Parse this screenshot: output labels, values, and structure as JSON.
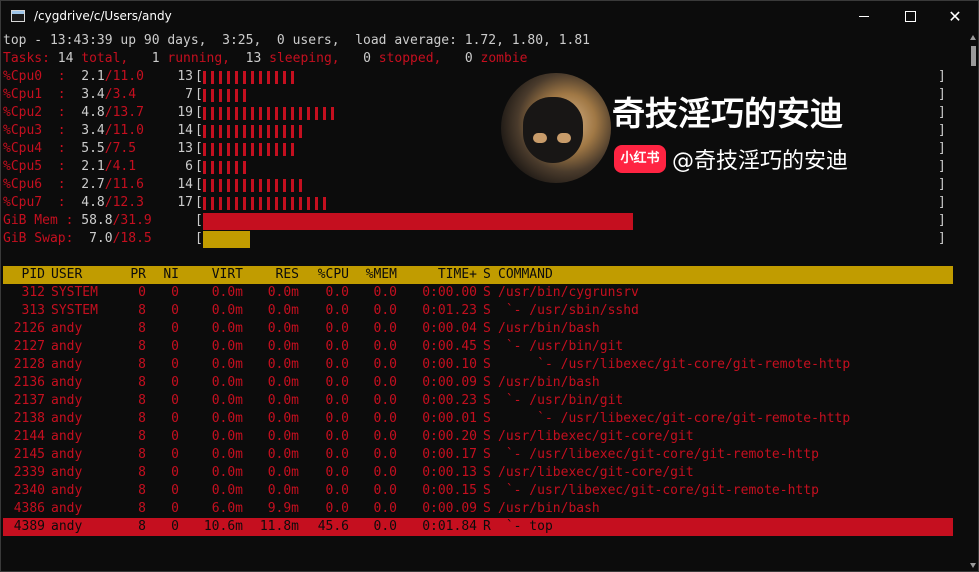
{
  "window": {
    "title": "/cygdrive/c/Users/andy",
    "icon": "terminal-icon",
    "minimize_icon": "minimize-icon",
    "maximize_icon": "maximize-icon",
    "close_icon": "close-icon",
    "close_glyph": "✕"
  },
  "colors": {
    "background": "#0c0c0c",
    "text": "#cccccc",
    "red": "#c50f1f",
    "yellow": "#c19c00"
  },
  "summary": {
    "uptime_line": "top - 13:43:39 up 90 days,  3:25,  0 users,  load average: 1.72, 1.80, 1.81",
    "tasks_label": "Tasks:",
    "tasks_total": " 14",
    "tasks_total_label": " total,",
    "tasks_running": "   1",
    "tasks_running_label": " running,",
    "tasks_sleeping": "  13",
    "tasks_sleeping_label": " sleeping,",
    "tasks_stopped": "   0",
    "tasks_stopped_label": " stopped,",
    "tasks_zombie": "   0",
    "tasks_zombie_label": " zombie"
  },
  "cpus": [
    {
      "label": "%Cpu0  :",
      "usage": "2.1",
      "max": "/11.0",
      "total": "13",
      "fraction": 0.13
    },
    {
      "label": "%Cpu1  :",
      "usage": "3.4",
      "max": "/3.4",
      "total": "7",
      "fraction": 0.07
    },
    {
      "label": "%Cpu2  :",
      "usage": "4.8",
      "max": "/13.7",
      "total": "19",
      "fraction": 0.19
    },
    {
      "label": "%Cpu3  :",
      "usage": "3.4",
      "max": "/11.0",
      "total": "14",
      "fraction": 0.14
    },
    {
      "label": "%Cpu4  :",
      "usage": "5.5",
      "max": "/7.5",
      "total": "13",
      "fraction": 0.13
    },
    {
      "label": "%Cpu5  :",
      "usage": "2.1",
      "max": "/4.1",
      "total": "6",
      "fraction": 0.06
    },
    {
      "label": "%Cpu6  :",
      "usage": "2.7",
      "max": "/11.6",
      "total": "14",
      "fraction": 0.14
    },
    {
      "label": "%Cpu7  :",
      "usage": "4.8",
      "max": "/12.3",
      "total": "17",
      "fraction": 0.17
    }
  ],
  "memory": {
    "label": "GiB Mem :",
    "used": "58.8",
    "total": "/31.9",
    "fraction": 0.58
  },
  "swap": {
    "label": "GiB Swap:",
    "used": "7.0",
    "total": "/18.5",
    "fraction": 0.064
  },
  "meter_open": "[",
  "meter_close": "]",
  "process_columns": [
    "PID",
    "USER",
    "PR",
    "NI",
    "VIRT",
    "RES",
    "%CPU",
    "%MEM",
    "TIME+",
    "S",
    "COMMAND"
  ],
  "processes": [
    {
      "pid": "312",
      "user": "SYSTEM",
      "pr": "0",
      "ni": "0",
      "virt": "0.0m",
      "res": "0.0m",
      "cpu": "0.0",
      "mem": "0.0",
      "time": "0:00.00",
      "s": "S",
      "command": "/usr/bin/cygrunsrv"
    },
    {
      "pid": "313",
      "user": "SYSTEM",
      "pr": "8",
      "ni": "0",
      "virt": "0.0m",
      "res": "0.0m",
      "cpu": "0.0",
      "mem": "0.0",
      "time": "0:01.23",
      "s": "S",
      "command": " `- /usr/sbin/sshd"
    },
    {
      "pid": "2126",
      "user": "andy",
      "pr": "8",
      "ni": "0",
      "virt": "0.0m",
      "res": "0.0m",
      "cpu": "0.0",
      "mem": "0.0",
      "time": "0:00.04",
      "s": "S",
      "command": "/usr/bin/bash"
    },
    {
      "pid": "2127",
      "user": "andy",
      "pr": "8",
      "ni": "0",
      "virt": "0.0m",
      "res": "0.0m",
      "cpu": "0.0",
      "mem": "0.0",
      "time": "0:00.45",
      "s": "S",
      "command": " `- /usr/bin/git"
    },
    {
      "pid": "2128",
      "user": "andy",
      "pr": "8",
      "ni": "0",
      "virt": "0.0m",
      "res": "0.0m",
      "cpu": "0.0",
      "mem": "0.0",
      "time": "0:00.10",
      "s": "S",
      "command": "     `- /usr/libexec/git-core/git-remote-http"
    },
    {
      "pid": "2136",
      "user": "andy",
      "pr": "8",
      "ni": "0",
      "virt": "0.0m",
      "res": "0.0m",
      "cpu": "0.0",
      "mem": "0.0",
      "time": "0:00.09",
      "s": "S",
      "command": "/usr/bin/bash"
    },
    {
      "pid": "2137",
      "user": "andy",
      "pr": "8",
      "ni": "0",
      "virt": "0.0m",
      "res": "0.0m",
      "cpu": "0.0",
      "mem": "0.0",
      "time": "0:00.23",
      "s": "S",
      "command": " `- /usr/bin/git"
    },
    {
      "pid": "2138",
      "user": "andy",
      "pr": "8",
      "ni": "0",
      "virt": "0.0m",
      "res": "0.0m",
      "cpu": "0.0",
      "mem": "0.0",
      "time": "0:00.01",
      "s": "S",
      "command": "     `- /usr/libexec/git-core/git-remote-http"
    },
    {
      "pid": "2144",
      "user": "andy",
      "pr": "8",
      "ni": "0",
      "virt": "0.0m",
      "res": "0.0m",
      "cpu": "0.0",
      "mem": "0.0",
      "time": "0:00.20",
      "s": "S",
      "command": "/usr/libexec/git-core/git"
    },
    {
      "pid": "2145",
      "user": "andy",
      "pr": "8",
      "ni": "0",
      "virt": "0.0m",
      "res": "0.0m",
      "cpu": "0.0",
      "mem": "0.0",
      "time": "0:00.17",
      "s": "S",
      "command": " `- /usr/libexec/git-core/git-remote-http"
    },
    {
      "pid": "2339",
      "user": "andy",
      "pr": "8",
      "ni": "0",
      "virt": "0.0m",
      "res": "0.0m",
      "cpu": "0.0",
      "mem": "0.0",
      "time": "0:00.13",
      "s": "S",
      "command": "/usr/libexec/git-core/git"
    },
    {
      "pid": "2340",
      "user": "andy",
      "pr": "8",
      "ni": "0",
      "virt": "0.0m",
      "res": "0.0m",
      "cpu": "0.0",
      "mem": "0.0",
      "time": "0:00.15",
      "s": "S",
      "command": " `- /usr/libexec/git-core/git-remote-http"
    },
    {
      "pid": "4386",
      "user": "andy",
      "pr": "8",
      "ni": "0",
      "virt": "6.0m",
      "res": "9.9m",
      "cpu": "0.0",
      "mem": "0.0",
      "time": "0:00.09",
      "s": "S",
      "command": "/usr/bin/bash"
    },
    {
      "pid": "4389",
      "user": "andy",
      "pr": "8",
      "ni": "0",
      "virt": "10.6m",
      "res": "11.8m",
      "cpu": "45.6",
      "mem": "0.0",
      "time": "0:01.84",
      "s": "R",
      "command": " `- top"
    }
  ],
  "selected_pid": "4389",
  "overlay": {
    "title": "奇技淫巧的安迪",
    "badge": "小红书",
    "handle": "@奇技淫巧的安迪"
  }
}
